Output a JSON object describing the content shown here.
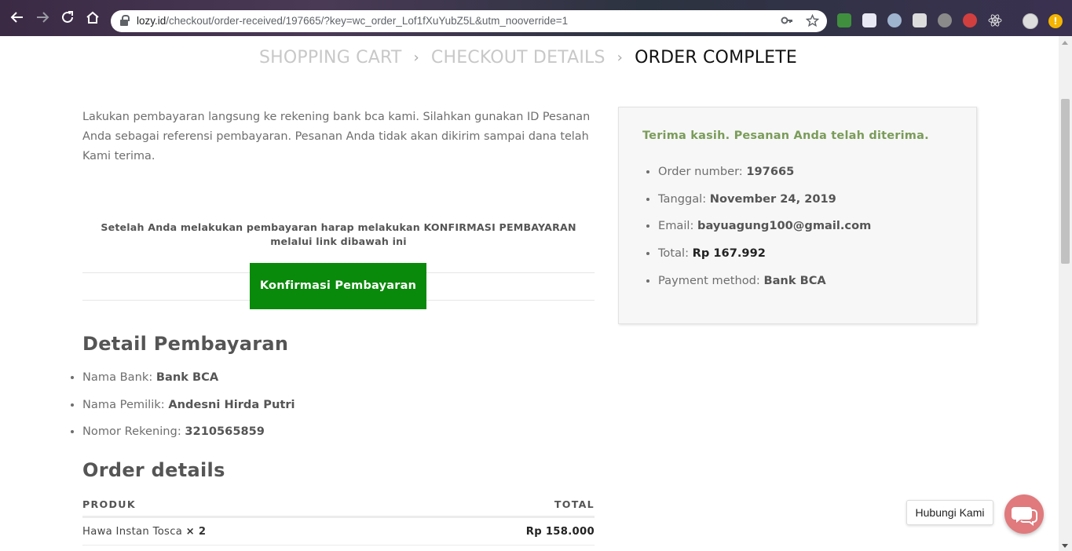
{
  "browser": {
    "back_icon": "arrow-left-icon",
    "forward_icon": "arrow-right-icon",
    "reload_icon": "reload-icon",
    "home_icon": "home-icon",
    "url_host": "lozy.id",
    "url_path": "/checkout/order-received/197665/?key=wc_order_Lof1fXuYubZ5L&utm_nooverride=1",
    "key_icon": "key-icon",
    "star_icon": "star-icon",
    "update_badge": "!"
  },
  "steps": {
    "cart": "SHOPPING CART",
    "checkout": "CHECKOUT DETAILS",
    "complete": "ORDER COMPLETE",
    "separator": "›"
  },
  "intro": "Lakukan pembayaran langsung ke rekening bank bca kami. Silahkan gunakan ID Pesanan Anda sebagai referensi pembayaran. Pesanan Anda tidak akan dikirim sampai dana telah Kami terima.",
  "confirm": {
    "note_line1": "Setelah Anda melakukan pembayaran harap melakukan KONFIRMASI PEMBAYARAN",
    "note_line2": "melalui link dibawah ini",
    "button": "Konfirmasi Pembayaran"
  },
  "payment_details": {
    "title": "Detail Pembayaran",
    "bank_label": "Nama Bank:",
    "bank_value": "Bank BCA",
    "owner_label": "Nama Pemilik:",
    "owner_value": "Andesni Hirda Putri",
    "account_label": "Nomor Rekening:",
    "account_value": "3210565859"
  },
  "order_details": {
    "title": "Order details",
    "col_product": "PRODUK",
    "col_total": "TOTAL",
    "rows": [
      {
        "product": "Hawa Instan Tosca",
        "qty": "× 2",
        "amount": "Rp 158.000"
      }
    ]
  },
  "summary": {
    "thanks": "Terima kasih. Pesanan Anda telah diterima.",
    "order_number_label": "Order number:",
    "order_number": "197665",
    "date_label": "Tanggal:",
    "date": "November 24, 2019",
    "email_label": "Email:",
    "email": "bayuagung100@gmail.com",
    "total_label": "Total:",
    "total": "Rp 167.992",
    "method_label": "Payment method:",
    "method": "Bank BCA"
  },
  "chat": {
    "label": "Hubungi Kami",
    "icon": "chat-bubbles-icon",
    "color": "#e07a7d"
  },
  "colors": {
    "accent_green": "#0a8a0a",
    "thanks_green": "#7a9c59"
  }
}
